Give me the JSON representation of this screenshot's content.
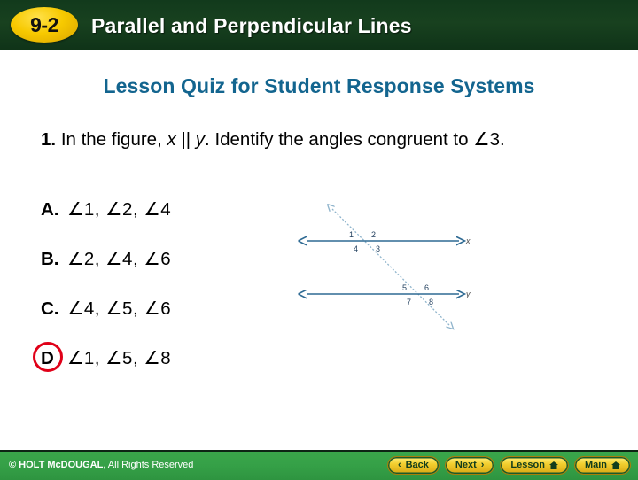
{
  "header": {
    "lesson_number": "9-2",
    "title": "Parallel and Perpendicular Lines"
  },
  "subtitle": "Lesson Quiz for Student Response Systems",
  "question": {
    "number": "1.",
    "text_part1": "In the figure,",
    "var_x": "x",
    "parallel_symbol": "||",
    "var_y": "y",
    "text_part2": ". Identify the angles congruent to ∠3."
  },
  "choices": [
    {
      "letter": "A.",
      "text": "∠1,  ∠2,  ∠4",
      "correct": false
    },
    {
      "letter": "B.",
      "text": "∠2,  ∠4,  ∠6",
      "correct": false
    },
    {
      "letter": "C.",
      "text": "∠4,  ∠5,  ∠6",
      "correct": false
    },
    {
      "letter": "D",
      "text": "∠1,  ∠5,  ∠8",
      "correct": true
    }
  ],
  "figure": {
    "line_x_label": "x",
    "line_y_label": "y",
    "angles": {
      "a1": "1",
      "a2": "2",
      "a3": "3",
      "a4": "4",
      "a5": "5",
      "a6": "6",
      "a7": "7",
      "a8": "8"
    },
    "line_color": "#2e6a93",
    "transversal_color": "#8fb4cc"
  },
  "footer": {
    "copyright_strong": "© HOLT McDOUGAL",
    "copyright_rest": ", All Rights Reserved",
    "buttons": [
      {
        "label": "Back",
        "chevron": "‹",
        "chevron_side": "left",
        "home": false
      },
      {
        "label": "Next",
        "chevron": "›",
        "chevron_side": "right",
        "home": false
      },
      {
        "label": "Lesson",
        "chevron": "",
        "chevron_side": "none",
        "home": true
      },
      {
        "label": "Main",
        "chevron": "",
        "chevron_side": "none",
        "home": true
      }
    ]
  },
  "colors": {
    "header_bg": "#16401f",
    "badge": "#f7c900",
    "subtitle": "#13658f",
    "footer_bg": "#35a047",
    "correct_ring": "#e00018"
  }
}
